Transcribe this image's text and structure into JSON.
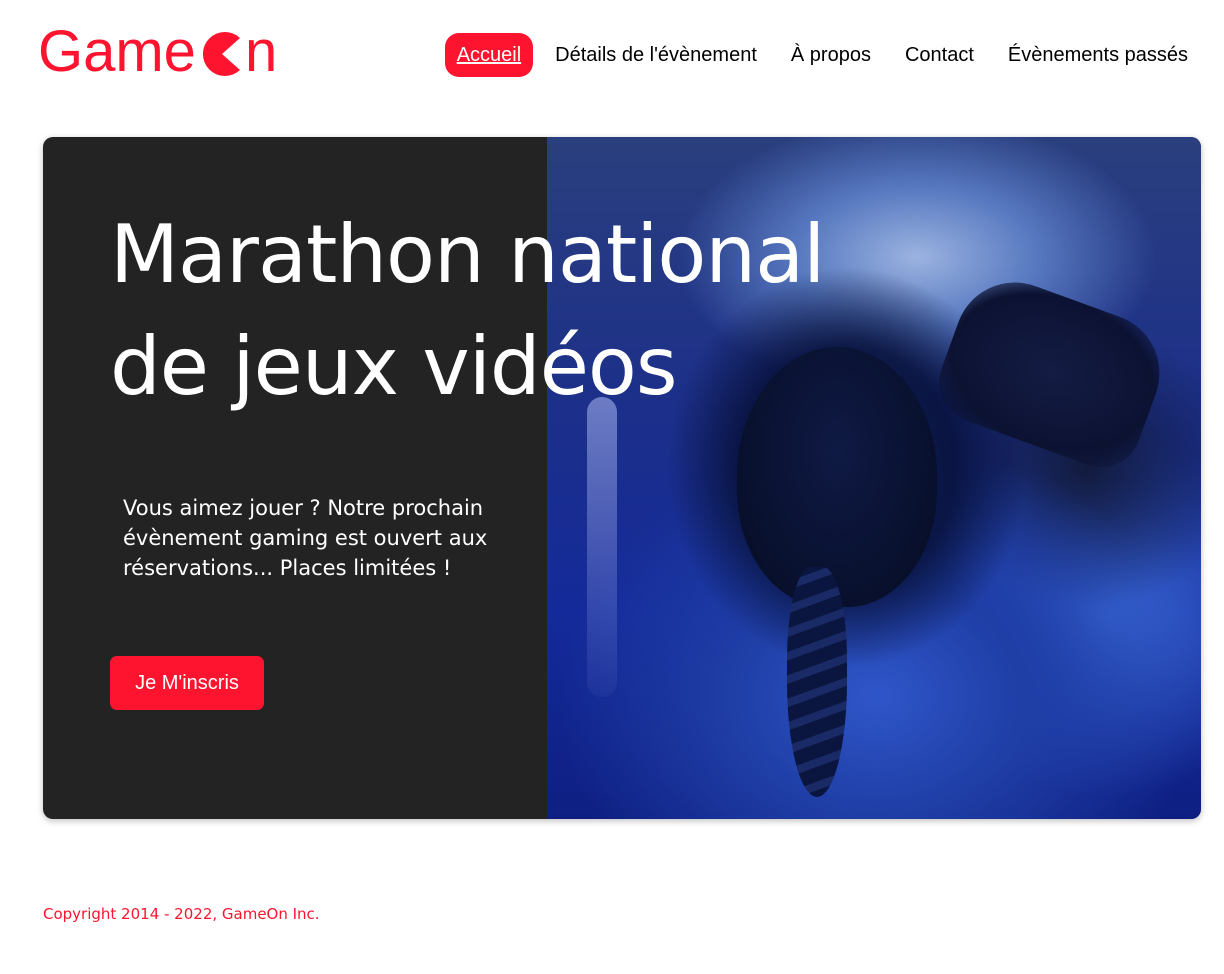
{
  "header": {
    "logo_text_before": "Game",
    "logo_text_after": "n",
    "nav": [
      {
        "label": "Accueil",
        "active": true
      },
      {
        "label": "Détails de l'évènement",
        "active": false
      },
      {
        "label": "À propos",
        "active": false
      },
      {
        "label": "Contact",
        "active": false
      },
      {
        "label": "Évènements passés",
        "active": false
      }
    ]
  },
  "hero": {
    "title": "Marathon national de jeux vidéos",
    "description": "Vous aimez jouer ? Notre prochain évènement gaming est ouvert aux réservations... Places limitées !",
    "cta_label": "Je M'inscris"
  },
  "footer": {
    "copyright": "Copyright 2014 - 2022, GameOn Inc."
  },
  "colors": {
    "brand": "#fe142f",
    "hero_bg": "#232323",
    "text_dark": "#000000",
    "text_light": "#ffffff"
  },
  "icons": {
    "logo_mark": "pacman-icon"
  }
}
